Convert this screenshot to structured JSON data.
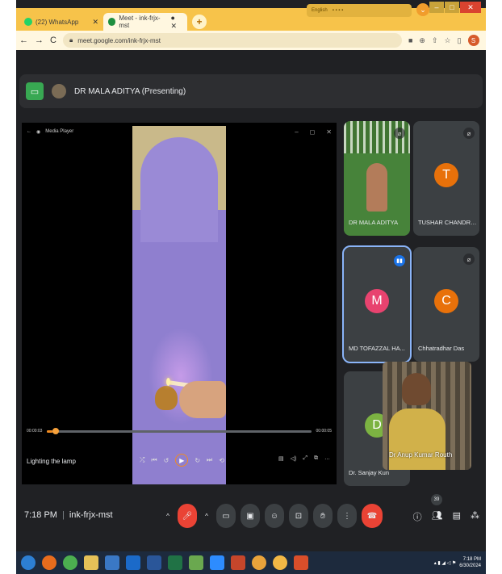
{
  "browser": {
    "tabs": [
      {
        "label": "(22) WhatsApp",
        "favicon": "whatsapp-icon",
        "color": "#25d366"
      },
      {
        "label": "Meet - ink-frjx-mst",
        "favicon": "meet-icon",
        "color": "#1e8e3e"
      }
    ],
    "tray_text": "English",
    "url": "meet.google.com/ink-frjx-mst",
    "profile_initial": "S"
  },
  "meet": {
    "presenter": "DR MALA ADITYA (Presenting)",
    "media_player": {
      "window_title": "Media Player",
      "time_start": "00:00:03",
      "time_end": "00:00:05",
      "caption": "Lighting the lamp"
    },
    "participants": [
      {
        "name": "DR MALA ADITYA",
        "initial": "",
        "color": "#47833a",
        "muted": true
      },
      {
        "name": "TUSHAR CHANDRA...",
        "initial": "T",
        "color": "#e8710a",
        "muted": true
      },
      {
        "name": "MD TOFAZZAL HA...",
        "initial": "M",
        "color": "#e8436f",
        "muted": false,
        "speaking": true
      },
      {
        "name": "Chhatradhar Das",
        "initial": "C",
        "color": "#e8710a",
        "muted": true
      },
      {
        "name": "Dr. Sanjay Kun",
        "initial": "D",
        "color": "#7cb342",
        "muted": false
      },
      {
        "name": "Dr Anup Kumar Routh",
        "initial": "",
        "color": "#5c5244",
        "muted": false
      }
    ],
    "time": "7:18 PM",
    "meeting_code": "ink-frjx-mst",
    "participant_count": "39"
  },
  "taskbar": {
    "time": "7:18 PM",
    "date": "6/30/2024"
  }
}
